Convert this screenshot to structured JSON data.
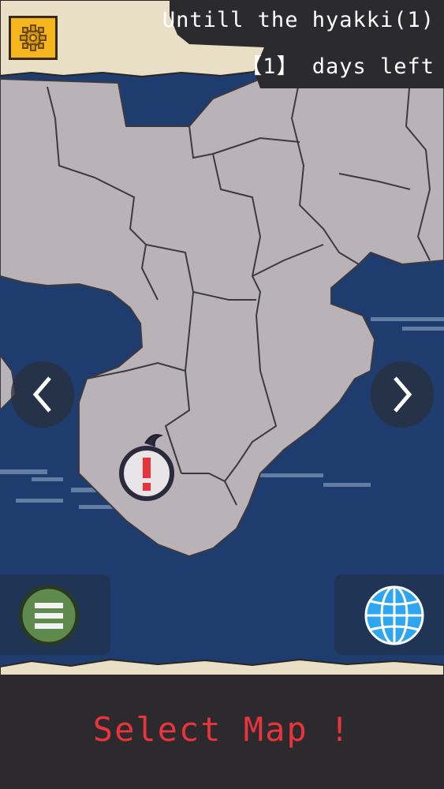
{
  "header": {
    "countdown_title": "Untill the hyakki(1)",
    "days_left": "【1】 days left"
  },
  "icons": {
    "settings": "gear-icon",
    "prev": "chevron-left-icon",
    "next": "chevron-right-icon",
    "menu": "hamburger-menu-icon",
    "world": "globe-icon",
    "event": "exclamation-marker-icon"
  },
  "footer": {
    "prompt": "Select Map !"
  },
  "colors": {
    "sea": "#1e3d6e",
    "land": "#b9b3b8",
    "paper": "#e8dfc6",
    "prompt": "#e8343c",
    "settings_button": "#f4b51d",
    "menu_button": "#5f8a4e",
    "globe": "#2ea6f0"
  }
}
